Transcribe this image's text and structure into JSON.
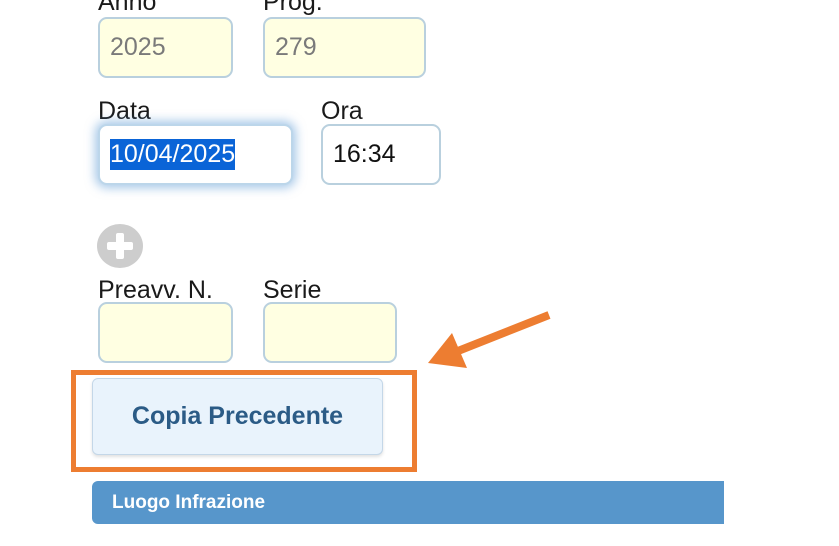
{
  "form": {
    "anno": {
      "label": "Anno",
      "value": "2025"
    },
    "prog": {
      "label": "Prog.",
      "value": "279"
    },
    "data": {
      "label": "Data",
      "value": "10/04/2025"
    },
    "ora": {
      "label": "Ora",
      "value": "16:34"
    },
    "add_icon": "plus-circle-icon",
    "preavviso": {
      "label": "Preavv. N.",
      "value": ""
    },
    "serie": {
      "label": "Serie",
      "value": ""
    }
  },
  "copy_button": {
    "label": "Copia Precedente"
  },
  "section": {
    "luogo_title": "Luogo Infrazione"
  },
  "colors": {
    "field_background": "#ffffe2",
    "highlight": "#ed7d31",
    "section_bar": "#5796cb",
    "button_text": "#2b5b86",
    "selection": "#0a64d7"
  }
}
